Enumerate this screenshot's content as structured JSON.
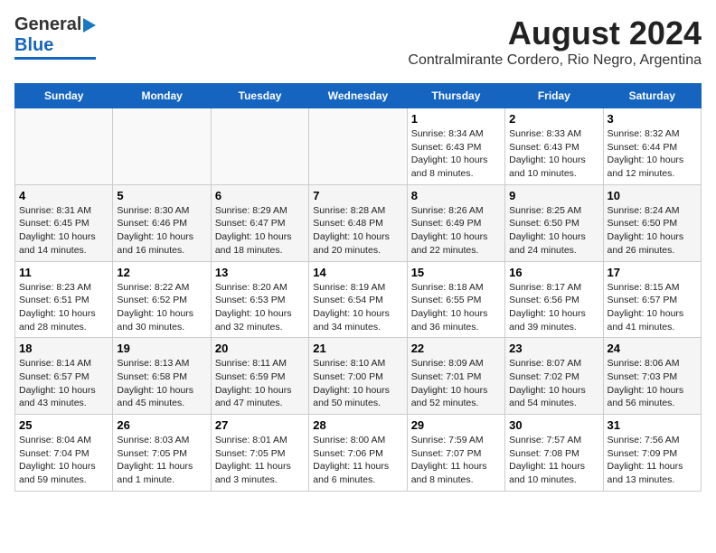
{
  "logo": {
    "general": "General",
    "blue": "Blue"
  },
  "header": {
    "month": "August 2024",
    "location": "Contralmirante Cordero, Rio Negro, Argentina"
  },
  "weekdays": [
    "Sunday",
    "Monday",
    "Tuesday",
    "Wednesday",
    "Thursday",
    "Friday",
    "Saturday"
  ],
  "weeks": [
    [
      {
        "day": "",
        "info": ""
      },
      {
        "day": "",
        "info": ""
      },
      {
        "day": "",
        "info": ""
      },
      {
        "day": "",
        "info": ""
      },
      {
        "day": "1",
        "info": "Sunrise: 8:34 AM\nSunset: 6:43 PM\nDaylight: 10 hours\nand 8 minutes."
      },
      {
        "day": "2",
        "info": "Sunrise: 8:33 AM\nSunset: 6:43 PM\nDaylight: 10 hours\nand 10 minutes."
      },
      {
        "day": "3",
        "info": "Sunrise: 8:32 AM\nSunset: 6:44 PM\nDaylight: 10 hours\nand 12 minutes."
      }
    ],
    [
      {
        "day": "4",
        "info": "Sunrise: 8:31 AM\nSunset: 6:45 PM\nDaylight: 10 hours\nand 14 minutes."
      },
      {
        "day": "5",
        "info": "Sunrise: 8:30 AM\nSunset: 6:46 PM\nDaylight: 10 hours\nand 16 minutes."
      },
      {
        "day": "6",
        "info": "Sunrise: 8:29 AM\nSunset: 6:47 PM\nDaylight: 10 hours\nand 18 minutes."
      },
      {
        "day": "7",
        "info": "Sunrise: 8:28 AM\nSunset: 6:48 PM\nDaylight: 10 hours\nand 20 minutes."
      },
      {
        "day": "8",
        "info": "Sunrise: 8:26 AM\nSunset: 6:49 PM\nDaylight: 10 hours\nand 22 minutes."
      },
      {
        "day": "9",
        "info": "Sunrise: 8:25 AM\nSunset: 6:50 PM\nDaylight: 10 hours\nand 24 minutes."
      },
      {
        "day": "10",
        "info": "Sunrise: 8:24 AM\nSunset: 6:50 PM\nDaylight: 10 hours\nand 26 minutes."
      }
    ],
    [
      {
        "day": "11",
        "info": "Sunrise: 8:23 AM\nSunset: 6:51 PM\nDaylight: 10 hours\nand 28 minutes."
      },
      {
        "day": "12",
        "info": "Sunrise: 8:22 AM\nSunset: 6:52 PM\nDaylight: 10 hours\nand 30 minutes."
      },
      {
        "day": "13",
        "info": "Sunrise: 8:20 AM\nSunset: 6:53 PM\nDaylight: 10 hours\nand 32 minutes."
      },
      {
        "day": "14",
        "info": "Sunrise: 8:19 AM\nSunset: 6:54 PM\nDaylight: 10 hours\nand 34 minutes."
      },
      {
        "day": "15",
        "info": "Sunrise: 8:18 AM\nSunset: 6:55 PM\nDaylight: 10 hours\nand 36 minutes."
      },
      {
        "day": "16",
        "info": "Sunrise: 8:17 AM\nSunset: 6:56 PM\nDaylight: 10 hours\nand 39 minutes."
      },
      {
        "day": "17",
        "info": "Sunrise: 8:15 AM\nSunset: 6:57 PM\nDaylight: 10 hours\nand 41 minutes."
      }
    ],
    [
      {
        "day": "18",
        "info": "Sunrise: 8:14 AM\nSunset: 6:57 PM\nDaylight: 10 hours\nand 43 minutes."
      },
      {
        "day": "19",
        "info": "Sunrise: 8:13 AM\nSunset: 6:58 PM\nDaylight: 10 hours\nand 45 minutes."
      },
      {
        "day": "20",
        "info": "Sunrise: 8:11 AM\nSunset: 6:59 PM\nDaylight: 10 hours\nand 47 minutes."
      },
      {
        "day": "21",
        "info": "Sunrise: 8:10 AM\nSunset: 7:00 PM\nDaylight: 10 hours\nand 50 minutes."
      },
      {
        "day": "22",
        "info": "Sunrise: 8:09 AM\nSunset: 7:01 PM\nDaylight: 10 hours\nand 52 minutes."
      },
      {
        "day": "23",
        "info": "Sunrise: 8:07 AM\nSunset: 7:02 PM\nDaylight: 10 hours\nand 54 minutes."
      },
      {
        "day": "24",
        "info": "Sunrise: 8:06 AM\nSunset: 7:03 PM\nDaylight: 10 hours\nand 56 minutes."
      }
    ],
    [
      {
        "day": "25",
        "info": "Sunrise: 8:04 AM\nSunset: 7:04 PM\nDaylight: 10 hours\nand 59 minutes."
      },
      {
        "day": "26",
        "info": "Sunrise: 8:03 AM\nSunset: 7:05 PM\nDaylight: 11 hours\nand 1 minute."
      },
      {
        "day": "27",
        "info": "Sunrise: 8:01 AM\nSunset: 7:05 PM\nDaylight: 11 hours\nand 3 minutes."
      },
      {
        "day": "28",
        "info": "Sunrise: 8:00 AM\nSunset: 7:06 PM\nDaylight: 11 hours\nand 6 minutes."
      },
      {
        "day": "29",
        "info": "Sunrise: 7:59 AM\nSunset: 7:07 PM\nDaylight: 11 hours\nand 8 minutes."
      },
      {
        "day": "30",
        "info": "Sunrise: 7:57 AM\nSunset: 7:08 PM\nDaylight: 11 hours\nand 10 minutes."
      },
      {
        "day": "31",
        "info": "Sunrise: 7:56 AM\nSunset: 7:09 PM\nDaylight: 11 hours\nand 13 minutes."
      }
    ]
  ]
}
